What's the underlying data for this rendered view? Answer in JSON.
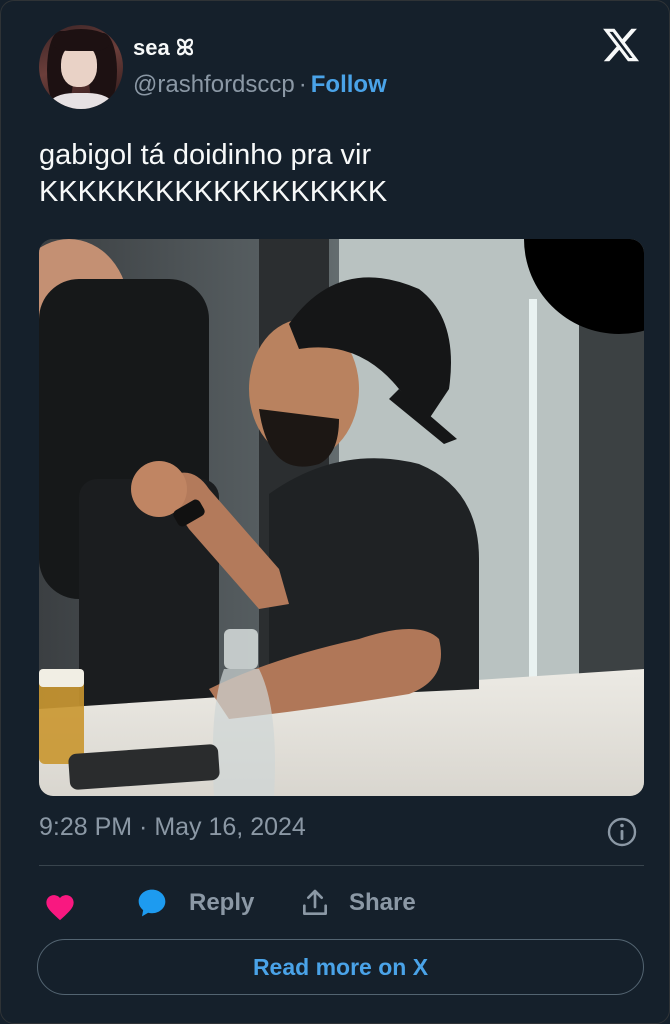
{
  "tweet": {
    "author": {
      "display_name": "sea ꕤ",
      "handle": "@rashfordsccp",
      "follow_label": "Follow"
    },
    "text_lines": [
      "gabigol tá doidinho pra vir",
      "KKKKKKKKKKKKKKKKKK"
    ],
    "media": {
      "description_icon": "photo"
    },
    "timestamp": "9:28 PM · May 16, 2024",
    "actions": {
      "reply_label": "Reply",
      "share_label": "Share"
    },
    "read_more_label": "Read more on X"
  },
  "brand": {
    "logo_icon": "x-logo-icon"
  },
  "colors": {
    "background": "#15202b",
    "accent": "#4aa3e8",
    "like": "#f91880",
    "muted": "#8b98a5"
  }
}
